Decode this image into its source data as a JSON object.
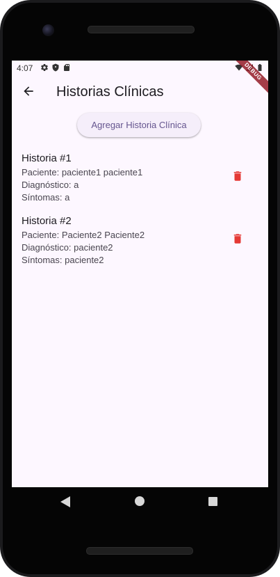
{
  "status_bar": {
    "time": "4:07",
    "left_icons": [
      "settings-icon",
      "shield-icon",
      "sd-card-icon"
    ],
    "right_icons": [
      "wifi-icon",
      "signal-icon",
      "battery-icon"
    ],
    "debug_banner": "DEBUG"
  },
  "appbar": {
    "back_icon": "arrow-back-icon",
    "title": "Historias Clínicas"
  },
  "actions": {
    "add_label": "Agregar Historia Clínica"
  },
  "records": [
    {
      "title": "Historia #1",
      "patient": "Paciente: paciente1 paciente1",
      "diagnosis": "Diagnóstico: a",
      "symptoms": "Síntomas: a"
    },
    {
      "title": "Historia #2",
      "patient": "Paciente: Paciente2 Paciente2",
      "diagnosis": "Diagnóstico: paciente2",
      "symptoms": "Síntomas: paciente2"
    }
  ],
  "colors": {
    "background": "#fdf7ff",
    "accent": "#65558f",
    "delete": "#e53935"
  },
  "navigation": {
    "icons": [
      "nav-back-icon",
      "nav-home-icon",
      "nav-recents-icon"
    ]
  }
}
